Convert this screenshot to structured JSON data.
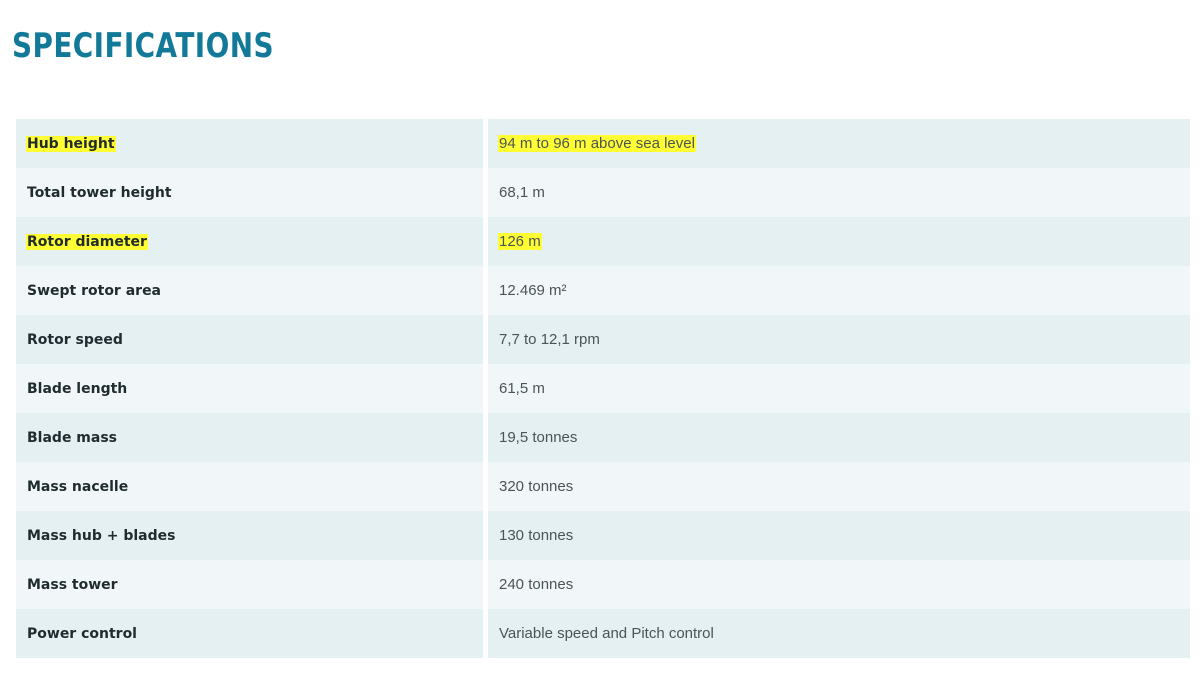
{
  "title": "SPECIFICATIONS",
  "highlight_color": "#ffff33",
  "rows": [
    {
      "label": "Hub height",
      "value": "94 m to 96 m above sea level",
      "highlighted": true
    },
    {
      "label": "Total tower height",
      "value": "68,1 m",
      "highlighted": false
    },
    {
      "label": "Rotor diameter",
      "value": "126 m",
      "highlighted": true
    },
    {
      "label": "Swept rotor area",
      "value": "12.469 m²",
      "highlighted": false
    },
    {
      "label": "Rotor speed",
      "value": "7,7 to 12,1 rpm",
      "highlighted": false
    },
    {
      "label": "Blade length",
      "value": "61,5 m",
      "highlighted": false
    },
    {
      "label": "Blade mass",
      "value": "19,5 tonnes",
      "highlighted": false
    },
    {
      "label": "Mass nacelle",
      "value": "320 tonnes",
      "highlighted": false
    },
    {
      "label": "Mass hub + blades",
      "value": "130 tonnes",
      "highlighted": false
    },
    {
      "label": "Mass tower",
      "value": "240 tonnes",
      "highlighted": false
    },
    {
      "label": "Power control",
      "value": "Variable speed and Pitch control",
      "highlighted": false
    }
  ]
}
